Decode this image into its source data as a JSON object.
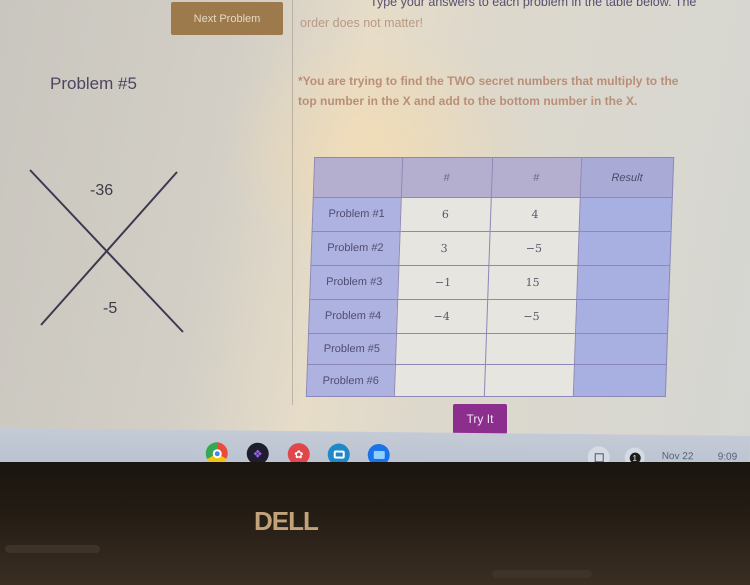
{
  "toolbar": {
    "next_problem_label": "Next Problem"
  },
  "instructions": {
    "line1": "Type your answers to each problem in the table below. The",
    "line2": "order does not matter!"
  },
  "problem": {
    "title": "Problem #5",
    "hint": "*You are trying to find the TWO secret numbers that multiply to the top number in the X and add to the bottom number in the X.",
    "x_top": "-36",
    "x_bottom": "-5"
  },
  "table": {
    "headers": [
      "",
      "#",
      "#",
      "Result"
    ],
    "rows": [
      {
        "label": "Problem #1",
        "a": "6",
        "b": "4",
        "result": ""
      },
      {
        "label": "Problem #2",
        "a": "3",
        "b": "−5",
        "result": ""
      },
      {
        "label": "Problem #3",
        "a": "−1",
        "b": "15",
        "result": ""
      },
      {
        "label": "Problem #4",
        "a": "−4",
        "b": "−5",
        "result": ""
      },
      {
        "label": "Problem #5",
        "a": "",
        "b": "",
        "result": ""
      },
      {
        "label": "Problem #6",
        "a": "",
        "b": "",
        "result": ""
      }
    ]
  },
  "actions": {
    "try_it_label": "Try It"
  },
  "shelf": {
    "apps": [
      {
        "name": "chrome-icon",
        "color": "#4caf50"
      },
      {
        "name": "figma-icon",
        "color": "#1e1e2e"
      },
      {
        "name": "art-palette-icon",
        "color": "#e0474c"
      },
      {
        "name": "screencast-icon",
        "color": "#1e88c8"
      },
      {
        "name": "files-icon",
        "color": "#1a73e8"
      }
    ],
    "notification_count": "1",
    "date": "Nov 22",
    "time": "9:09"
  },
  "device": {
    "brand": "DELL"
  }
}
